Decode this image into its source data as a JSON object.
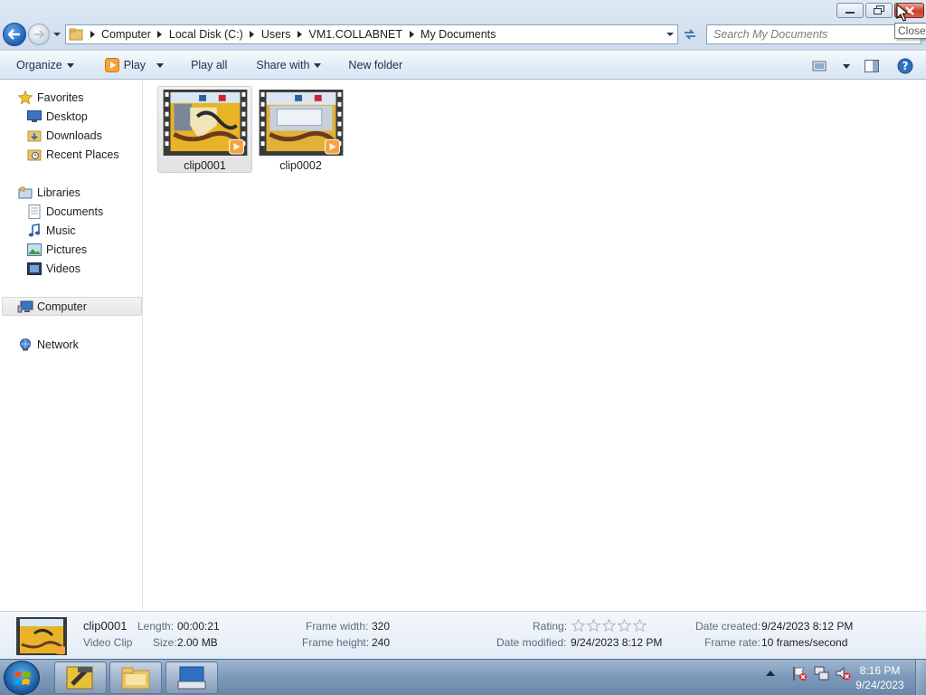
{
  "window": {
    "title_buttons": {
      "minimize_icon": "minimize-icon",
      "maximize_icon": "restore-icon",
      "close_icon": "close-icon"
    },
    "tooltip": "Close"
  },
  "address_bar": {
    "breadcrumbs": [
      "Computer",
      "Local Disk (C:)",
      "Users",
      "VM1.COLLABNET",
      "My Documents"
    ]
  },
  "search": {
    "placeholder": "Search My Documents"
  },
  "toolbar": {
    "organize": "Organize",
    "play": "Play",
    "play_all": "Play all",
    "share_with": "Share with",
    "new_folder": "New folder"
  },
  "navigation": {
    "favorites": {
      "label": "Favorites",
      "items": [
        "Desktop",
        "Downloads",
        "Recent Places"
      ]
    },
    "libraries": {
      "label": "Libraries",
      "items": [
        "Documents",
        "Music",
        "Pictures",
        "Videos"
      ]
    },
    "computer": "Computer",
    "network": "Network"
  },
  "files": [
    {
      "name": "clip0001",
      "selected": true
    },
    {
      "name": "clip0002",
      "selected": false
    }
  ],
  "details": {
    "name": "clip0001",
    "type": "Video Clip",
    "length_label": "Length:",
    "length": "00:00:21",
    "size_label": "Size:",
    "size": "2.00 MB",
    "frame_width_label": "Frame width:",
    "frame_width": "320",
    "frame_height_label": "Frame height:",
    "frame_height": "240",
    "rating_label": "Rating:",
    "rating": 0,
    "date_modified_label": "Date modified:",
    "date_modified": "9/24/2023 8:12 PM",
    "date_created_label": "Date created:",
    "date_created": "9/24/2023 8:12 PM",
    "frame_rate_label": "Frame rate:",
    "frame_rate": "10 frames/second"
  },
  "taskbar": {
    "time": "8:16 PM",
    "date": "9/24/2023"
  },
  "colors": {
    "accent": "#1b5fb7",
    "close_red": "#c7422a",
    "toolbar_text": "#1e3150"
  }
}
